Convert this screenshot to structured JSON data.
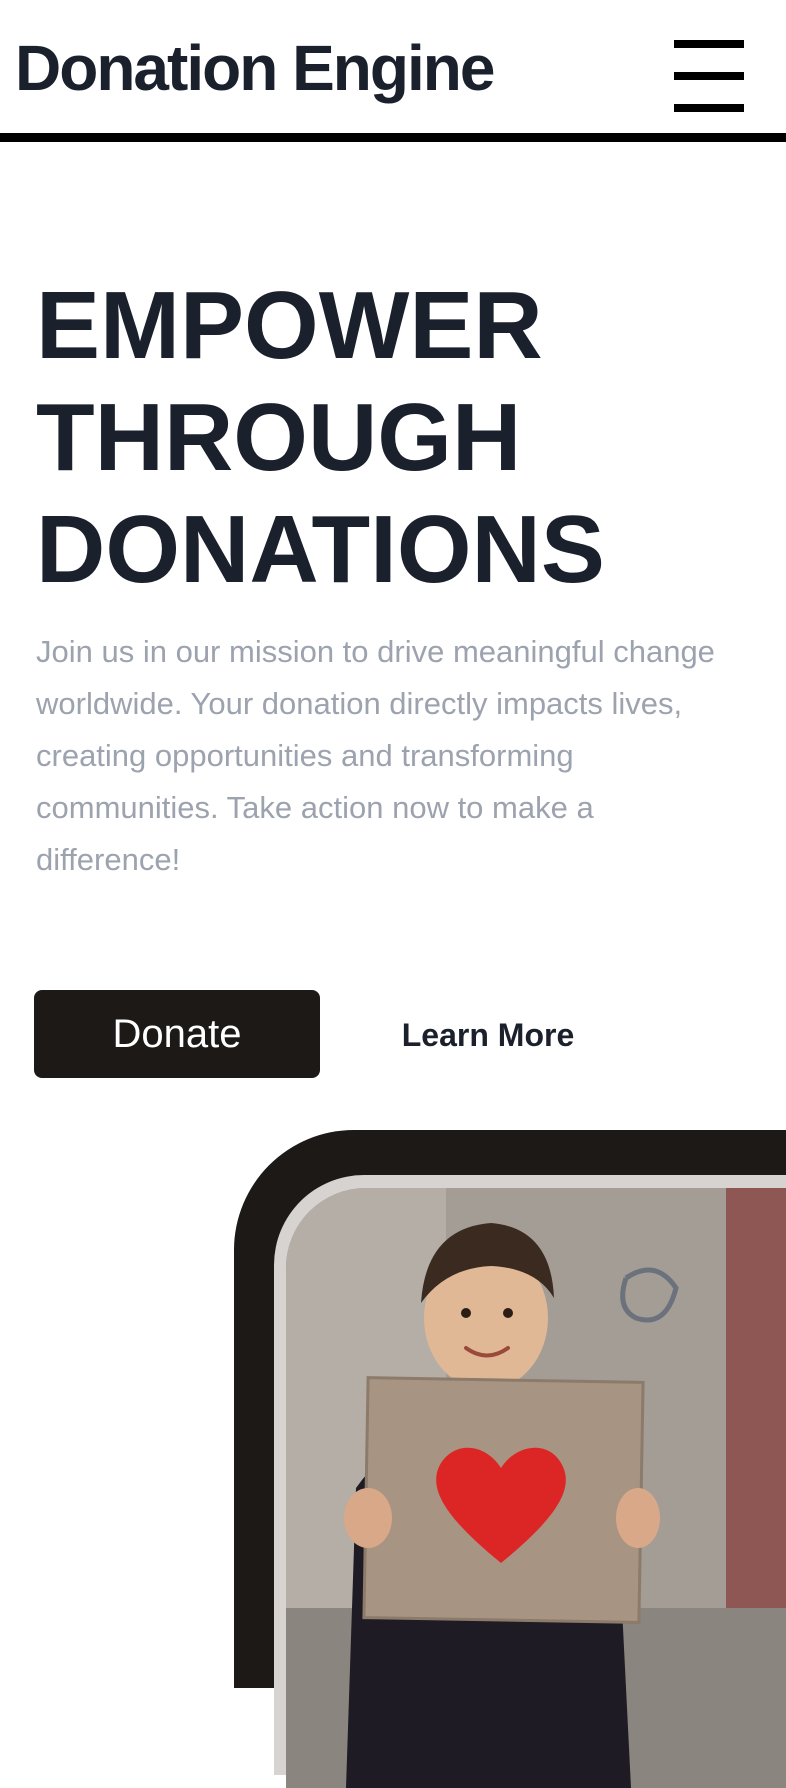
{
  "header": {
    "brand": "Donation Engine",
    "menu_icon": "hamburger-menu-icon"
  },
  "hero": {
    "title_lines": [
      "EMPOWER",
      "THROUGH",
      "DONATIONS"
    ],
    "description": "Join us in our mission to drive meaningful change worldwide. Your donation directly impacts lives, creating opportunities and transforming communities. Take action now to make a difference!",
    "primary_button": "Donate",
    "secondary_button": "Learn More"
  },
  "colors": {
    "text_dark": "#1a202c",
    "text_muted": "#9ca3af",
    "button_dark": "#1c1917",
    "frame_light": "#d6d3d1",
    "heart_red": "#dc2626"
  }
}
